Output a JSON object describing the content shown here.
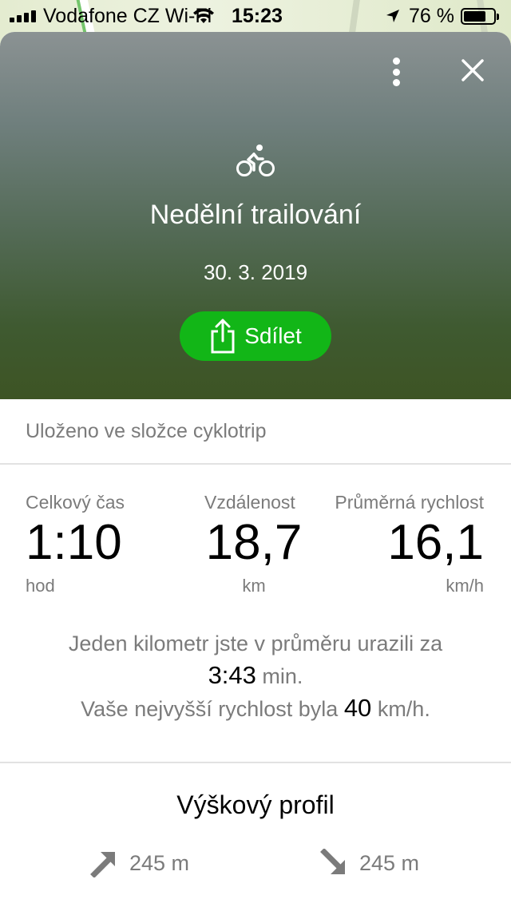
{
  "status_bar": {
    "carrier": "Vodafone CZ Wi-Fi",
    "time": "15:23",
    "battery": "76 %"
  },
  "hero": {
    "activity_icon": "bicycle-icon",
    "title": "Nedělní trailování",
    "date": "30. 3. 2019",
    "share_label": "Sdílet"
  },
  "folder": {
    "text": "Uloženo ve složce cyklotrip"
  },
  "stats": [
    {
      "label": "Celkový čas",
      "value": "1:10",
      "unit": "hod"
    },
    {
      "label": "Vzdálenost",
      "value": "18,7",
      "unit": "km"
    },
    {
      "label": "Průměrná rychlost",
      "value": "16,1",
      "unit": "km/h"
    }
  ],
  "summary": {
    "line1": "Jeden kilometr jste v průměru urazili za",
    "pace_value": "3:43",
    "pace_unit": "min.",
    "line3_prefix": "Vaše nejvyšší rychlost byla",
    "max_speed_value": "40",
    "max_speed_unit": "km/h."
  },
  "profile": {
    "title": "Výškový profil",
    "ascent": "245 m",
    "descent": "245 m"
  },
  "colors": {
    "accent_green": "#12b617",
    "muted_text": "#7b7b7b"
  }
}
